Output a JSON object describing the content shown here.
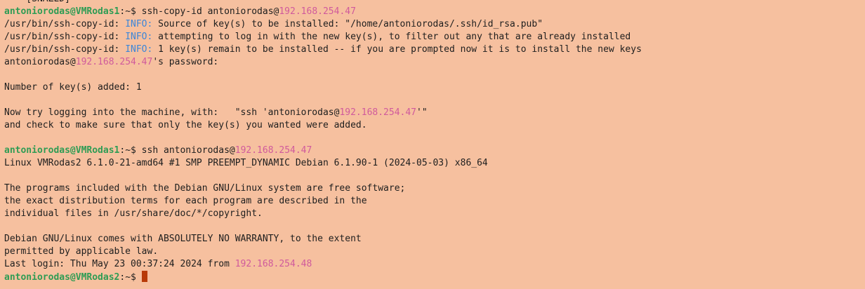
{
  "terminal": {
    "lines": [
      [
        {
          "t": "--- [SNAZED] ---",
          "c": "plain"
        }
      ],
      [
        {
          "t": "antoniorodas@VMRodas1",
          "c": "user"
        },
        {
          "t": ":~$ ssh-copy-id antoniorodas@",
          "c": "plain"
        },
        {
          "t": "192.168.254.47",
          "c": "ip"
        }
      ],
      [
        {
          "t": "/usr/bin/ssh-copy-id: ",
          "c": "plain"
        },
        {
          "t": "INFO:",
          "c": "info"
        },
        {
          "t": " Source of key(s) to be installed: \"/home/antoniorodas/.ssh/id_rsa.pub\"",
          "c": "plain"
        }
      ],
      [
        {
          "t": "/usr/bin/ssh-copy-id: ",
          "c": "plain"
        },
        {
          "t": "INFO:",
          "c": "info"
        },
        {
          "t": " attempting to log in with the new key(s), to filter out any that are already installed",
          "c": "plain"
        }
      ],
      [
        {
          "t": "/usr/bin/ssh-copy-id: ",
          "c": "plain"
        },
        {
          "t": "INFO:",
          "c": "info"
        },
        {
          "t": " 1 key(s) remain to be installed -- if you are prompted now it is to install the new keys",
          "c": "plain"
        }
      ],
      [
        {
          "t": "antoniorodas@",
          "c": "plain"
        },
        {
          "t": "192.168.254.47",
          "c": "ip"
        },
        {
          "t": "'s password:",
          "c": "plain"
        }
      ],
      [],
      [
        {
          "t": "Number of key(s) added: 1",
          "c": "plain"
        }
      ],
      [],
      [
        {
          "t": "Now try logging into the machine, with:   \"ssh 'antoniorodas@",
          "c": "plain"
        },
        {
          "t": "192.168.254.47",
          "c": "ip"
        },
        {
          "t": "'\"",
          "c": "plain"
        }
      ],
      [
        {
          "t": "and check to make sure that only the key(s) you wanted were added.",
          "c": "plain"
        }
      ],
      [],
      [
        {
          "t": "antoniorodas@VMRodas1",
          "c": "user"
        },
        {
          "t": ":~$ ssh antoniorodas@",
          "c": "plain"
        },
        {
          "t": "192.168.254.47",
          "c": "ip"
        }
      ],
      [
        {
          "t": "Linux VMRodas2 6.1.0-21-amd64 #1 SMP PREEMPT_DYNAMIC Debian 6.1.90-1 (2024-05-03) x86_64",
          "c": "plain"
        }
      ],
      [],
      [
        {
          "t": "The programs included with the Debian GNU/Linux system are free software;",
          "c": "plain"
        }
      ],
      [
        {
          "t": "the exact distribution terms for each program are described in the",
          "c": "plain"
        }
      ],
      [
        {
          "t": "individual files in /usr/share/doc/*/copyright.",
          "c": "plain"
        }
      ],
      [],
      [
        {
          "t": "Debian GNU/Linux comes with ABSOLUTELY NO WARRANTY, to the extent",
          "c": "plain"
        }
      ],
      [
        {
          "t": "permitted by applicable law.",
          "c": "plain"
        }
      ],
      [
        {
          "t": "Last login: Thu May 23 00:37:24 2024 from ",
          "c": "plain"
        },
        {
          "t": "192.168.254.48",
          "c": "ip"
        }
      ],
      [
        {
          "t": "antoniorodas@VMRodas2",
          "c": "user"
        },
        {
          "t": ":~$ ",
          "c": "plain"
        },
        {
          "t": "",
          "c": "cursor"
        }
      ]
    ]
  },
  "colors": {
    "background": "#f6c09f",
    "user": "#2e9c54",
    "ip": "#d05a9c",
    "info": "#3d86d8",
    "cursor": "#b83a08"
  }
}
